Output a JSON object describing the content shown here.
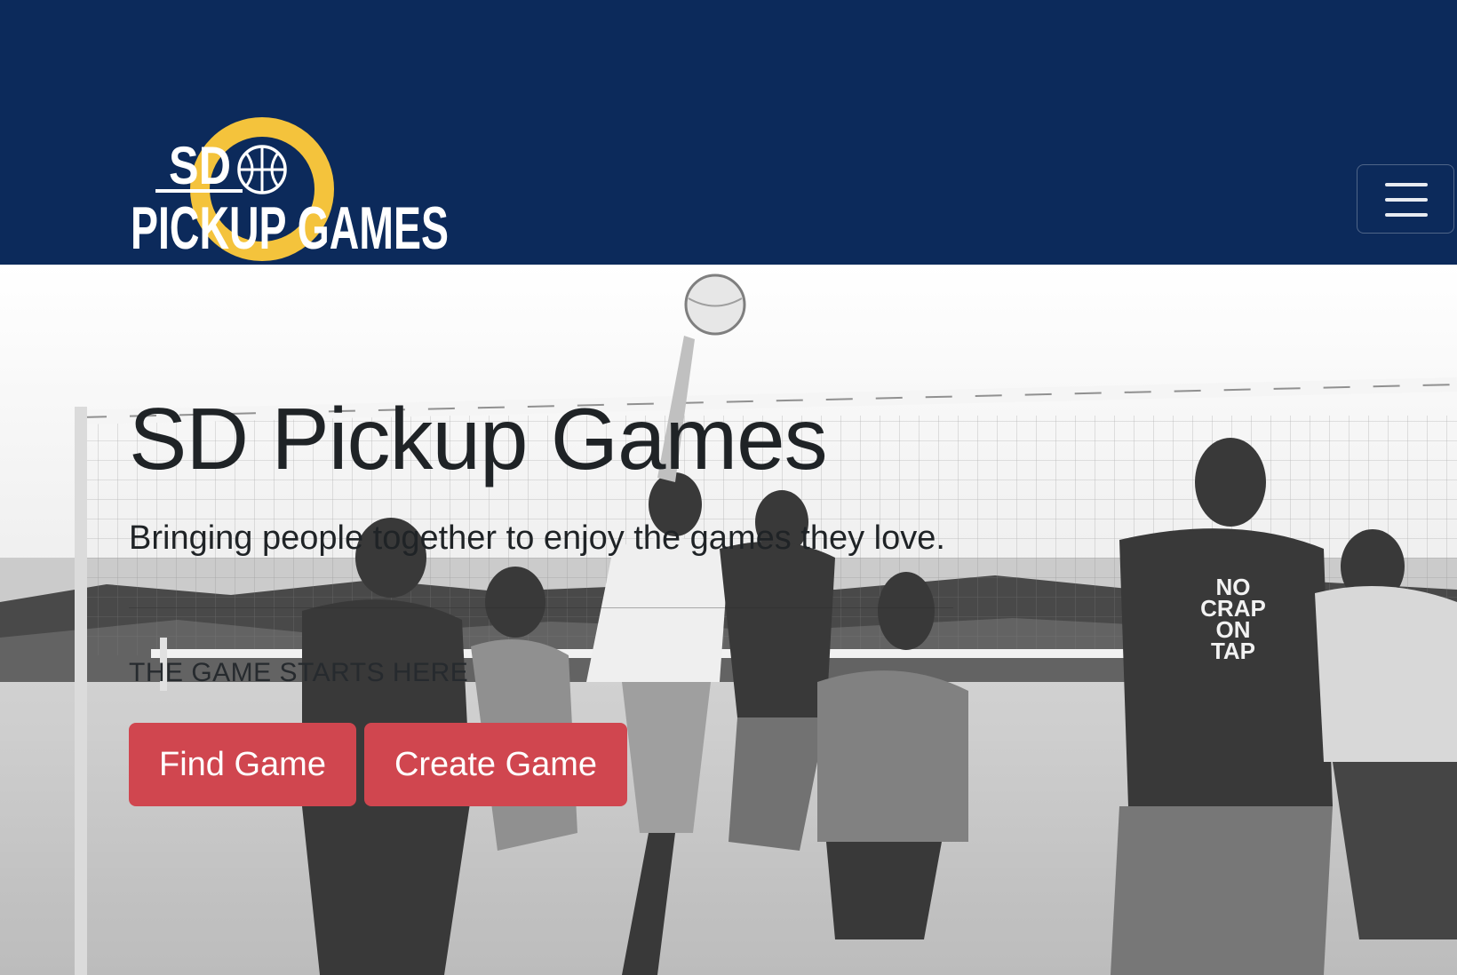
{
  "navbar": {
    "logo": {
      "line1": "SD",
      "line2": "PICKUP GAMES",
      "icon": "basketball-icon",
      "ring_color": "#f4c33c"
    },
    "menu_toggle": {
      "icon": "hamburger-icon"
    },
    "background_color": "#0c2a5b"
  },
  "hero": {
    "background_image": "black-and-white beach volleyball photo",
    "title": "SD Pickup Games",
    "lead": "Bringing people together to enjoy the games they love.",
    "tagline": "THE GAME STARTS HERE",
    "buttons": {
      "find": "Find Game",
      "create": "Create Game"
    },
    "button_color": "#d0464f"
  }
}
